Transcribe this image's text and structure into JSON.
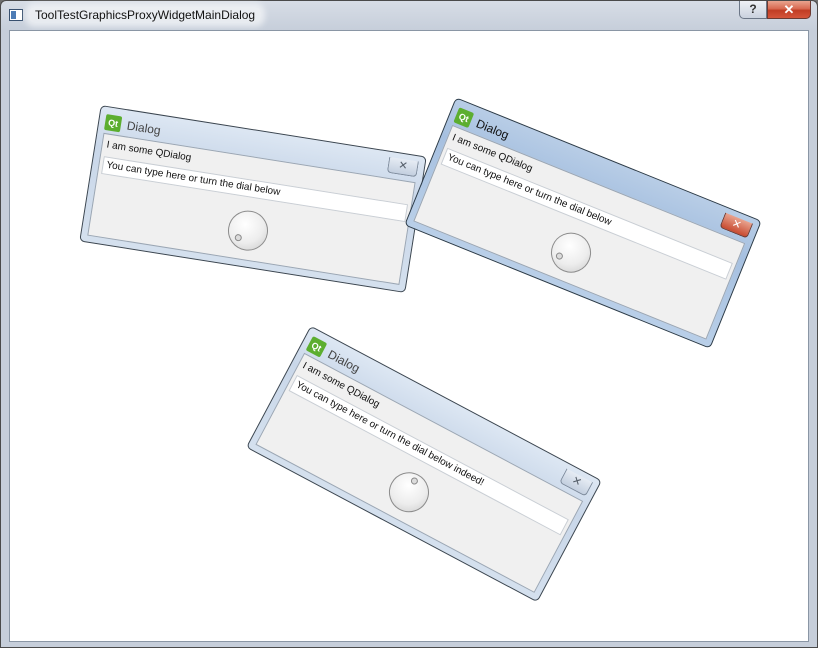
{
  "window": {
    "title": "ToolTestGraphicsProxyWidgetMainDialog",
    "help_label": "?",
    "close_label": "✕"
  },
  "dialogs": [
    {
      "title": "Dialog",
      "qt_logo": "Qt",
      "close_label": "✕",
      "label": "I am some QDialog",
      "input_value": "You can type here or turn the dial below",
      "active": false
    },
    {
      "title": "Dialog",
      "qt_logo": "Qt",
      "close_label": "✕",
      "label": "I am some QDialog",
      "input_value": "You can type here or turn the dial below",
      "active": true
    },
    {
      "title": "Dialog",
      "qt_logo": "Qt",
      "close_label": "✕",
      "label": "I am some QDialog",
      "input_value": "You can type here or turn the dial below indeed!",
      "active": false
    }
  ]
}
